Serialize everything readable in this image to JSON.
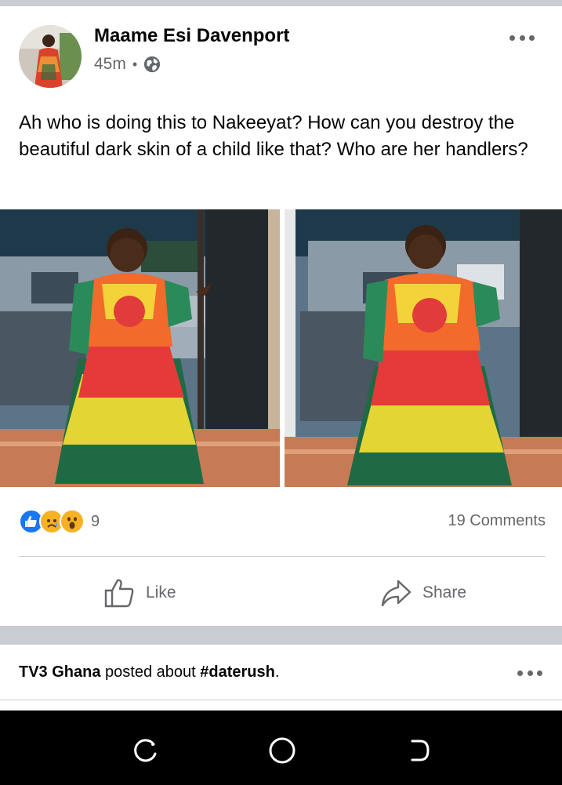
{
  "post": {
    "author": "Maame Esi Davenport",
    "time": "45m",
    "separator": "•",
    "privacy_icon": "globe-icon",
    "text": "Ah who is doing this to Nakeeyat? How can you destroy the beautiful dark skin of a child like that? Who are her handlers?",
    "reactions": {
      "icons": [
        "like-icon",
        "sad-icon",
        "wow-icon"
      ],
      "count": "9"
    },
    "comments": "19 Comments",
    "actions": {
      "like_label": "Like",
      "share_label": "Share"
    }
  },
  "next_post": {
    "page": "TV3 Ghana",
    "middle": " posted about ",
    "hashtag": "#daterush",
    "end": "."
  },
  "nav": {
    "icons": [
      "recent-apps-icon",
      "home-icon",
      "back-icon"
    ]
  },
  "colors": {
    "separator": "#c9ccd1",
    "secondary_text": "#65676b",
    "like_blue": "#1877f2",
    "reaction_yellow": "#f7b125"
  }
}
